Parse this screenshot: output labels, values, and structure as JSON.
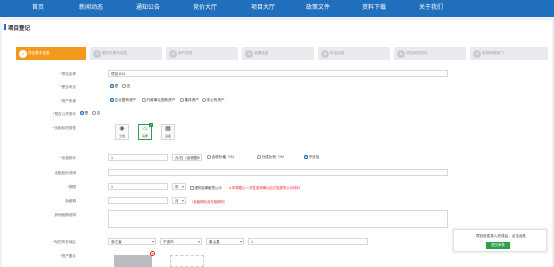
{
  "nav": {
    "items": [
      "首页",
      "新闻动态",
      "通知公告",
      "竞价大厅",
      "项目大厅",
      "政策文件",
      "资料下载",
      "关于我们"
    ]
  },
  "section_title": "项目登记",
  "steps": [
    {
      "num": "1",
      "label": "项目基本信息",
      "active": true
    },
    {
      "num": "2",
      "label": "委托方基本信息",
      "active": false
    },
    {
      "num": "3",
      "label": "资产信息",
      "active": false
    },
    {
      "num": "4",
      "label": "披露信息",
      "active": false
    },
    {
      "num": "5",
      "label": "拆估信息",
      "active": false
    },
    {
      "num": "6",
      "label": "项目相关附件",
      "active": false
    },
    {
      "num": "7",
      "label": "选择审核部门",
      "active": false
    }
  ],
  "form": {
    "project_name": {
      "label": "项目名称",
      "value": "项目1111"
    },
    "judicial": {
      "label": "是否司法",
      "options": [
        "是",
        "否"
      ],
      "selected": "是"
    },
    "asset_source": {
      "label": "资产来源",
      "options": [
        "企业国有资产",
        "行政事业国有资产",
        "集体资产",
        "非公有资产"
      ],
      "selected": "企业国有资产"
    },
    "public_bid": {
      "label": "是否公开竞价",
      "options": [
        "是",
        "否"
      ],
      "selected": "是"
    },
    "target_type": {
      "label": "出租标的类型",
      "cards": [
        {
          "icon": "land-icon",
          "label": "土地"
        },
        {
          "icon": "house-icon",
          "label": "房屋"
        },
        {
          "icon": "equipment-icon",
          "label": "设备"
        }
      ],
      "selected": "房屋"
    },
    "rent_price": {
      "label": "出租底价",
      "value": "1",
      "unit": "元/日（含税额）",
      "modes": [
        "含税价格（%）",
        "分成比例（%）",
        "不涉及"
      ],
      "selected_mode": "不涉及"
    },
    "rent_remark": {
      "label": "出租底价说明",
      "value": ""
    },
    "period": {
      "label": "期限",
      "value": "1",
      "unit": "年",
      "checkbox": "提供延期租赁公示",
      "warning": "年期限以一次性或请确认后方能提供公示材料"
    },
    "free_period": {
      "label": "免租期",
      "value": "",
      "unit": "月",
      "hint": "（免租期包含在租期内）"
    },
    "other_remark": {
      "label": "其他租期说明",
      "value": ""
    },
    "location": {
      "label": "标的所在地区",
      "province": "浙江省",
      "city": "宁波市",
      "district": "象山县",
      "detail": "1"
    },
    "images": {
      "label": "资产图片"
    }
  },
  "toast": {
    "text": "项目信息录入完成后，点击此处",
    "button": "提交审核"
  }
}
